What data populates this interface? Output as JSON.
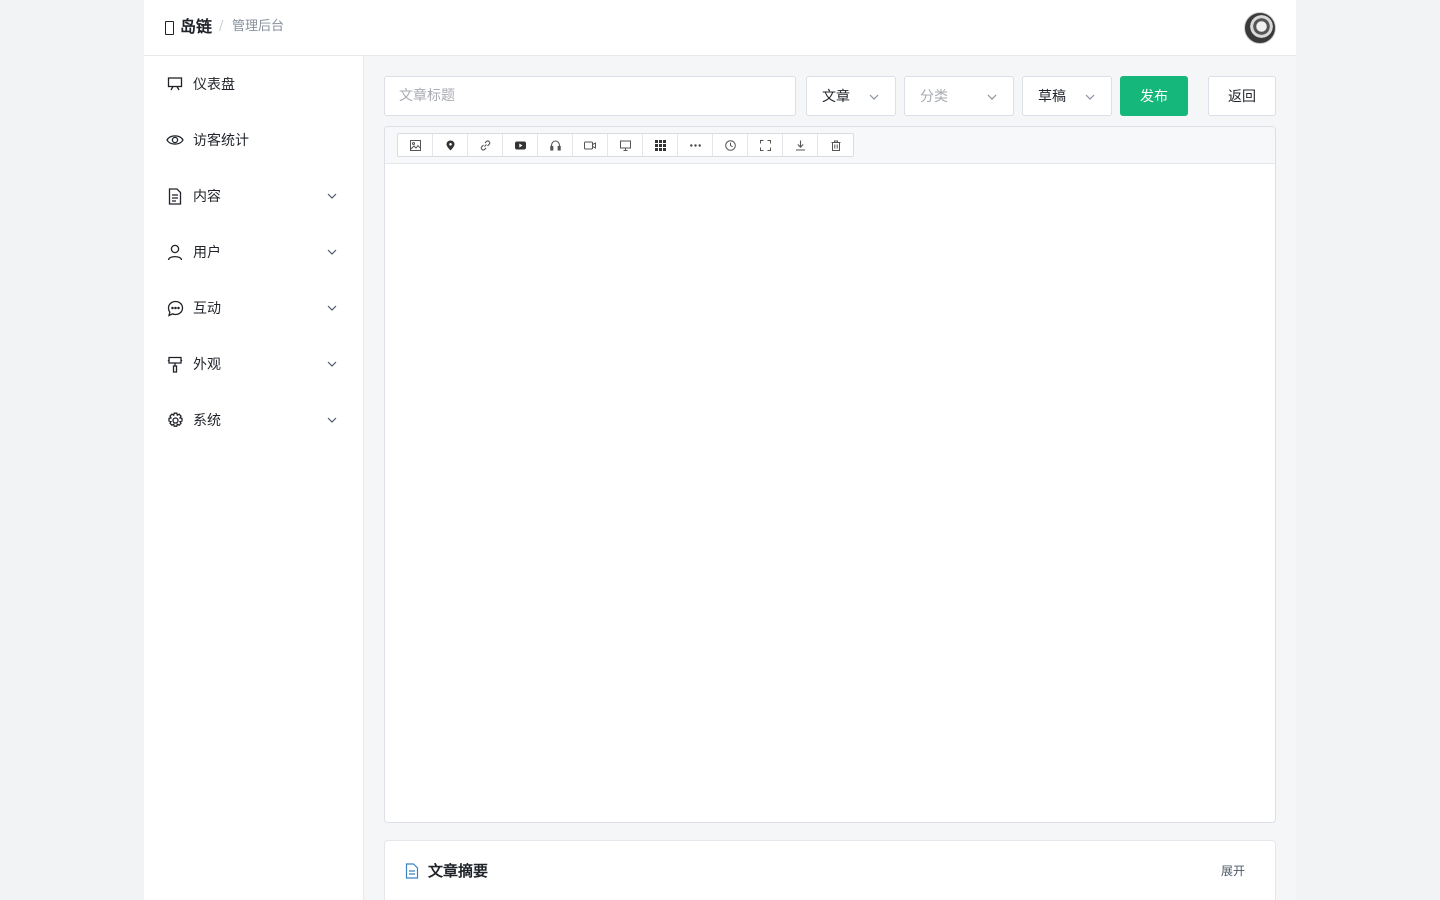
{
  "header": {
    "brand_name": "岛链",
    "separator": "/",
    "subtitle": "管理后台",
    "avatar_icon": "user-avatar"
  },
  "sidebar": {
    "items": [
      {
        "label": "仪表盘",
        "icon": "dashboard-icon",
        "expandable": false
      },
      {
        "label": "访客统计",
        "icon": "eye-icon",
        "expandable": false
      },
      {
        "label": "内容",
        "icon": "document-icon",
        "expandable": true
      },
      {
        "label": "用户",
        "icon": "user-icon",
        "expandable": true
      },
      {
        "label": "互动",
        "icon": "chat-icon",
        "expandable": true
      },
      {
        "label": "外观",
        "icon": "brush-icon",
        "expandable": true
      },
      {
        "label": "系统",
        "icon": "gear-icon",
        "expandable": true
      }
    ]
  },
  "form": {
    "title_placeholder": "文章标题",
    "title_value": "",
    "type_select": "文章",
    "category_placeholder": "分类",
    "status_select": "草稿",
    "publish_label": "发布",
    "back_label": "返回"
  },
  "toolbar": {
    "tools": [
      "image-icon",
      "location-icon",
      "link-icon",
      "youtube-icon",
      "audio-icon",
      "video-icon",
      "monitor-icon",
      "grid-icon",
      "more-icon",
      "clock-icon",
      "fullscreen-icon",
      "download-icon",
      "trash-icon"
    ]
  },
  "summary": {
    "title": "文章摘要",
    "expand_label": "展开"
  },
  "colors": {
    "accent": "#16b77a",
    "link_icon": "#3b82c4"
  }
}
